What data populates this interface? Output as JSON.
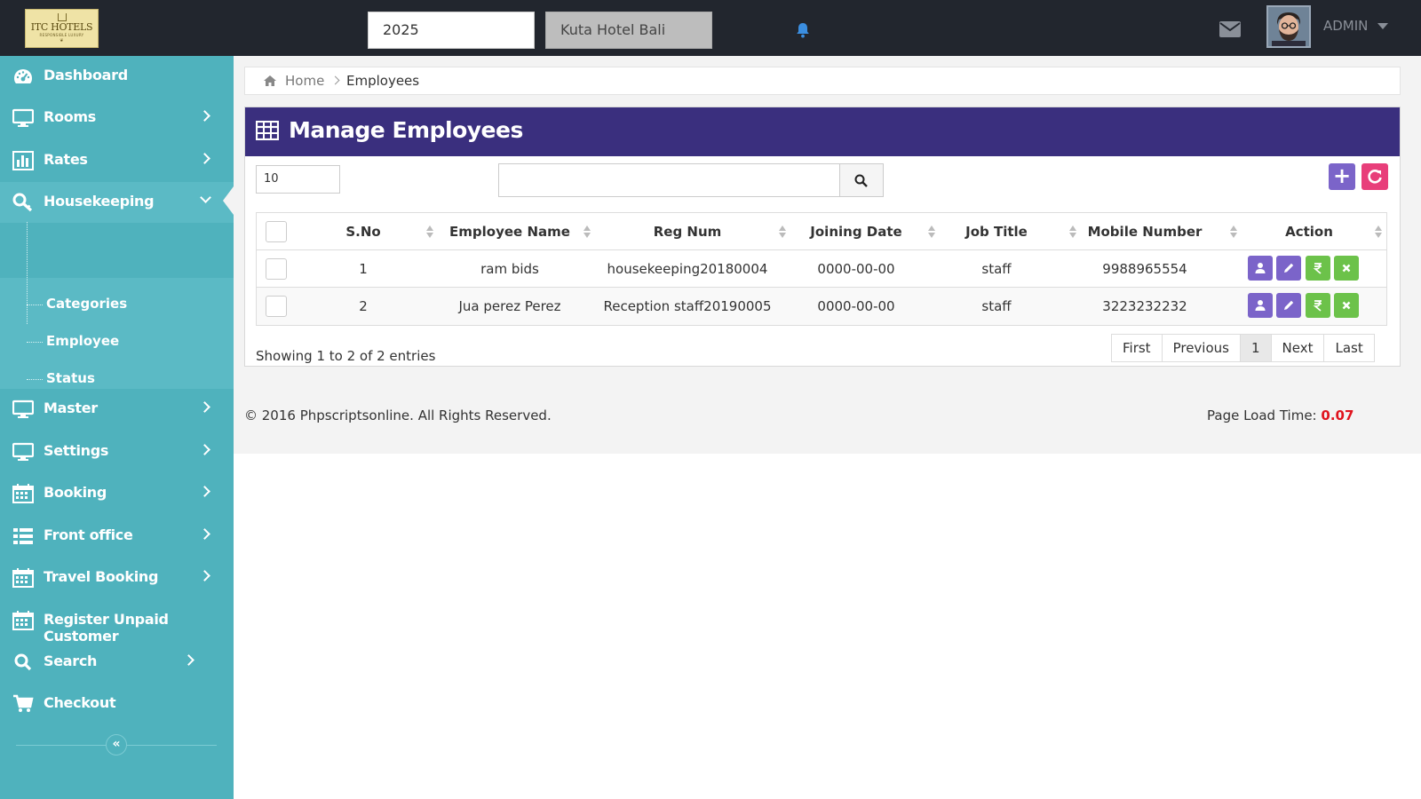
{
  "header": {
    "logo": {
      "name": "ITC HOTELS",
      "tagline": "RESPONSIBLE LUXURY"
    },
    "year": "2025",
    "hotel": "Kuta Hotel Bali",
    "user": "ADMIN"
  },
  "sidebar": {
    "items": [
      {
        "label": "Dashboard",
        "icon": "dashboard-icon"
      },
      {
        "label": "Rooms",
        "icon": "monitor-icon"
      },
      {
        "label": "Rates",
        "icon": "bar-chart-icon"
      },
      {
        "label": "Housekeeping",
        "icon": "key-icon"
      },
      {
        "label": "Master",
        "icon": "monitor-icon"
      },
      {
        "label": "Settings",
        "icon": "monitor-icon"
      },
      {
        "label": "Booking",
        "icon": "calendar-icon"
      },
      {
        "label": "Front office",
        "icon": "list-icon"
      },
      {
        "label": "Travel Booking",
        "icon": "calendar-icon"
      },
      {
        "label": "Register Unpaid Customer",
        "icon": "calendar-icon"
      },
      {
        "label": "Search",
        "icon": "search-icon"
      },
      {
        "label": "Checkout",
        "icon": "cart-icon"
      }
    ],
    "submenu": [
      "Categories",
      "Employee",
      "Status"
    ],
    "collapse": "«"
  },
  "breadcrumb": {
    "home": "Home",
    "current": "Employees"
  },
  "panel": {
    "title": "Manage Employees",
    "page_length": "10",
    "search_value": "",
    "add_symbol": "+"
  },
  "table": {
    "columns": [
      "S.No",
      "Employee Name",
      "Reg Num",
      "Joining Date",
      "Job Title",
      "Mobile Number",
      "Action"
    ],
    "rows": [
      [
        "1",
        "ram bids",
        "housekeeping20180004",
        "0000-00-00",
        "staff",
        "9988965554"
      ],
      [
        "2",
        "Jua perez Perez",
        "Reception staff20190005",
        "0000-00-00",
        "staff",
        "3223232232"
      ]
    ],
    "action_colors": {
      "view": "#7b64c9",
      "edit": "#7b64c9",
      "payment": "#6cc24a",
      "delete": "#6cc24a"
    }
  },
  "footer_info": "Showing 1 to 2 of 2 entries",
  "pagination": [
    "First",
    "Previous",
    "1",
    "Next",
    "Last"
  ],
  "footer": {
    "copyright": "© 2016 Phpscriptsonline. All Rights Reserved.",
    "load_label": "Page Load Time:",
    "load_value": "0.07"
  },
  "colors": {
    "topbar": "#22262e",
    "sidebar": "#4fb2bd",
    "panel_header": "#3a2f7e",
    "accent_purple": "#7b64c9",
    "accent_pink": "#e83e7a",
    "accent_green": "#6cc24a",
    "load_time": "#e0141e"
  }
}
